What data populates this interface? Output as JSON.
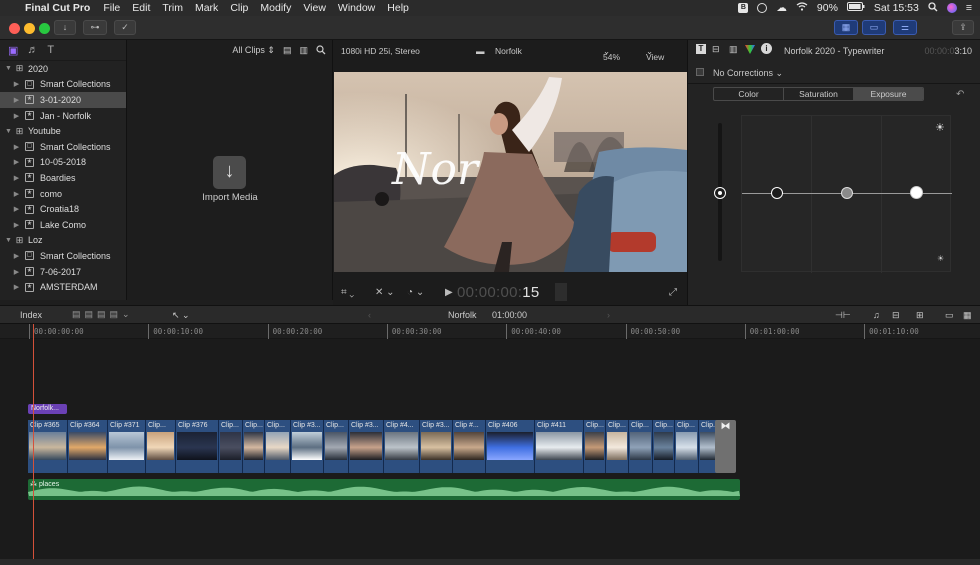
{
  "menubar": {
    "app_name": "Final Cut Pro",
    "menus": [
      "File",
      "Edit",
      "Trim",
      "Mark",
      "Clip",
      "Modify",
      "View",
      "Window",
      "Help"
    ],
    "battery": "90%",
    "clock": "Sat 15:53"
  },
  "library": {
    "items": [
      {
        "label": "2020",
        "kind": "event-library",
        "indent": 0
      },
      {
        "label": "Smart Collections",
        "kind": "folder",
        "indent": 1
      },
      {
        "label": "3-01-2020",
        "kind": "event",
        "indent": 1,
        "selected": true
      },
      {
        "label": "Jan - Norfolk",
        "kind": "event",
        "indent": 1
      },
      {
        "label": "Youtube",
        "kind": "event-library",
        "indent": 0
      },
      {
        "label": "Smart Collections",
        "kind": "folder",
        "indent": 1
      },
      {
        "label": "10-05-2018",
        "kind": "event",
        "indent": 1
      },
      {
        "label": "Boardies",
        "kind": "event",
        "indent": 1
      },
      {
        "label": "como",
        "kind": "event",
        "indent": 1
      },
      {
        "label": "Croatia18",
        "kind": "event",
        "indent": 1
      },
      {
        "label": "Lake Como",
        "kind": "event",
        "indent": 1
      },
      {
        "label": "Loz",
        "kind": "event-library",
        "indent": 0
      },
      {
        "label": "Smart Collections",
        "kind": "folder",
        "indent": 1
      },
      {
        "label": "7-06-2017",
        "kind": "event",
        "indent": 1
      },
      {
        "label": "AMSTERDAM",
        "kind": "event",
        "indent": 1
      }
    ]
  },
  "browser": {
    "filter_label": "All Clips",
    "import_label": "Import Media"
  },
  "viewer": {
    "format": "1080i HD 25i, Stereo",
    "project": "Norfolk",
    "zoom": "54%",
    "view_menu": "View",
    "timecode_dim": "00:00:00:",
    "timecode_frames": "15",
    "title_overlay": "Nor"
  },
  "inspector": {
    "title": "Norfolk 2020 - Typewriter",
    "timecode_dim": "00:00:0",
    "timecode": "3:10",
    "corrections": "No Corrections",
    "tabs": [
      {
        "label": "Color",
        "active": false
      },
      {
        "label": "Saturation",
        "active": false
      },
      {
        "label": "Exposure",
        "active": true
      }
    ]
  },
  "timeline": {
    "index_label": "Index",
    "project": "Norfolk",
    "duration": "01:00:00",
    "ruler": [
      "00:00:00:00",
      "00:00:10:00",
      "00:00:20:00",
      "00:00:30:00",
      "00:00:40:00",
      "00:00:50:00",
      "00:01:00:00",
      "00:01:10:00"
    ],
    "title_clip": "Norfolk...",
    "audio_clip": "places",
    "clips": [
      {
        "label": "Clip #365"
      },
      {
        "label": "Clip #364"
      },
      {
        "label": "Clip #371"
      },
      {
        "label": "Clip..."
      },
      {
        "label": "Clip #376"
      },
      {
        "label": "Clip..."
      },
      {
        "label": "Clip..."
      },
      {
        "label": "Clip..."
      },
      {
        "label": "Clip #3..."
      },
      {
        "label": "Clip..."
      },
      {
        "label": "Clip #3..."
      },
      {
        "label": "Clip #4..."
      },
      {
        "label": "Clip #3..."
      },
      {
        "label": "Clip #..."
      },
      {
        "label": "Clip #406"
      },
      {
        "label": "Clip #411"
      },
      {
        "label": "Clip..."
      },
      {
        "label": "Clip..."
      },
      {
        "label": "Clip..."
      },
      {
        "label": "Clip..."
      },
      {
        "label": "Clip..."
      },
      {
        "label": "Clip..."
      }
    ]
  },
  "colors": {
    "accent_purple": "#6b41b5",
    "clip_blue": "#2d4f80",
    "audio_green": "#1d6a35",
    "playhead": "#d4513a"
  }
}
